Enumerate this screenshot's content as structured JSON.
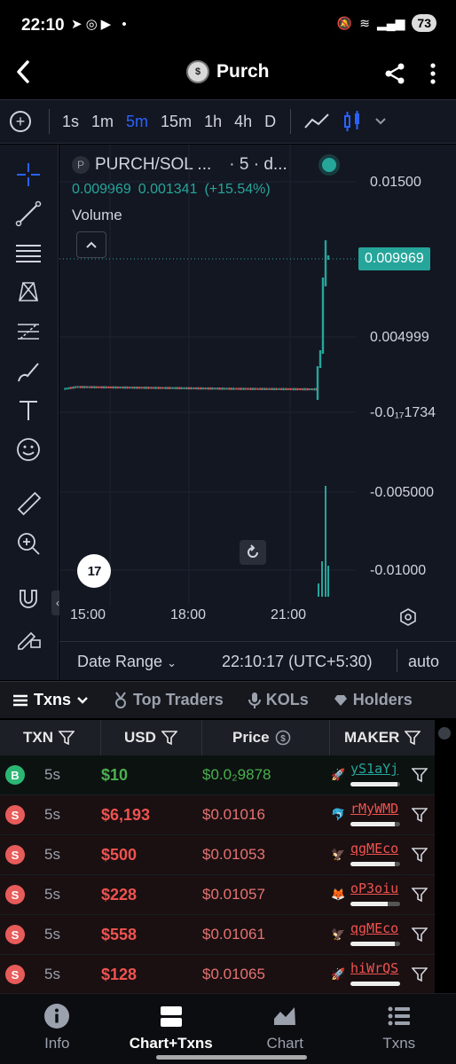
{
  "status_bar": {
    "time": "22:10",
    "battery": "73"
  },
  "header": {
    "title": "Purch"
  },
  "toolbar": {
    "timeframes": [
      "1s",
      "1m",
      "5m",
      "15m",
      "1h",
      "4h",
      "D"
    ],
    "active_timeframe": "5m"
  },
  "chart": {
    "symbol": "PURCH/SOL ...",
    "interval": "· 5 · d...",
    "ohlc_close": "0.009969",
    "ohlc_change": "0.001341",
    "ohlc_change_pct": "(+15.54%)",
    "volume_label": "Volume",
    "price_axis": [
      "0.01500",
      "0.004999",
      "-0.0₁₇1734",
      "-0.005000",
      "-0.01000"
    ],
    "last_price": "0.009969",
    "time_axis": [
      "15:00",
      "18:00",
      "21:00"
    ],
    "date_range": "Date Range",
    "clock": "22:10:17 (UTC+5:30)",
    "scale_mode": "auto",
    "colors": {
      "up": "#26a69a",
      "down": "#ef5350",
      "accent": "#2962ff"
    }
  },
  "tabs": [
    "Txns",
    "Top Traders",
    "KOLs",
    "Holders"
  ],
  "table": {
    "headers": {
      "txn": "TXN",
      "usd": "USD",
      "price": "Price",
      "maker": "MAKER"
    },
    "rows": [
      {
        "type": "B",
        "age": "5s",
        "usd": "$10",
        "price": "$0.0₂9878",
        "maker": "yS1aYj",
        "side": "buy",
        "bar": 0.95
      },
      {
        "type": "S",
        "age": "5s",
        "usd": "$6,193",
        "price": "$0.01016",
        "maker": "rMyWMD",
        "side": "sell",
        "bar": 0.9
      },
      {
        "type": "S",
        "age": "5s",
        "usd": "$500",
        "price": "$0.01053",
        "maker": "qgMEco",
        "side": "sell",
        "bar": 0.9
      },
      {
        "type": "S",
        "age": "5s",
        "usd": "$228",
        "price": "$0.01057",
        "maker": "oP3oiu",
        "side": "sell",
        "bar": 0.75
      },
      {
        "type": "S",
        "age": "5s",
        "usd": "$558",
        "price": "$0.01061",
        "maker": "qgMEco",
        "side": "sell",
        "bar": 0.9
      },
      {
        "type": "S",
        "age": "5s",
        "usd": "$128",
        "price": "$0.01065",
        "maker": "hiWrQS",
        "side": "sell",
        "bar": 1.0
      }
    ]
  },
  "bottom_nav": [
    {
      "label": "Info",
      "icon": "info-icon"
    },
    {
      "label": "Chart+Txns",
      "icon": "chart-txns-icon",
      "active": true
    },
    {
      "label": "Chart",
      "icon": "chart-icon"
    },
    {
      "label": "Txns",
      "icon": "txns-list-icon"
    }
  ]
}
